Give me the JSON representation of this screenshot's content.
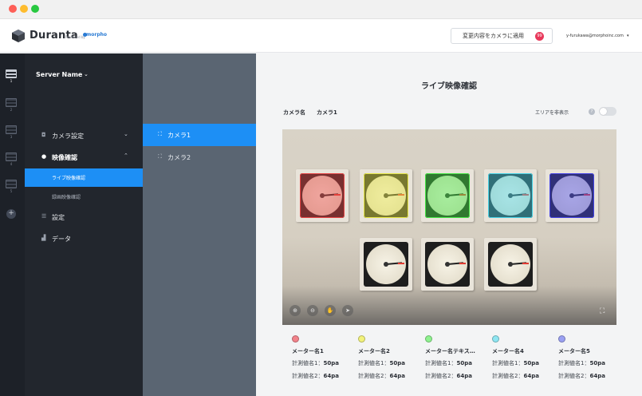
{
  "header": {
    "logo_text": "Duranta",
    "produced_by": "Produced by",
    "brand": "morpho",
    "apply_button": "変更内容をカメラに適用",
    "apply_badge": "99",
    "user_email": "y-furukawa@morphoinc.com",
    "user_caret": "▾"
  },
  "rail": {
    "items": [
      {
        "num": "1",
        "active": true
      },
      {
        "num": "2",
        "active": false
      },
      {
        "num": "3",
        "active": false
      },
      {
        "num": "4",
        "active": false
      },
      {
        "num": "5",
        "active": false
      }
    ],
    "add": "+"
  },
  "nav": {
    "server_name": "Server Name",
    "server_caret": "⌄",
    "camera_settings": "カメラ設定",
    "video_check": "映像確認",
    "live_check": "ライブ映像確認",
    "recorded_check": "録画映像確認",
    "settings": "設定",
    "data": "データ"
  },
  "cameras": [
    {
      "label": "カメラ1",
      "active": true
    },
    {
      "label": "カメラ2",
      "active": false
    }
  ],
  "main": {
    "title": "ライブ映像確認",
    "camera_name_label": "カメラ名",
    "camera_name_value": "カメラ1",
    "area_hide_label": "エリアを非表示",
    "help": "?"
  },
  "gauges": {
    "top_row_colors": [
      "#e64646",
      "#e6e646",
      "#46e646",
      "#46d2e6",
      "#4646e6"
    ]
  },
  "meters": [
    {
      "name": "メーター名1",
      "color": "#f2828a",
      "row1_label": "計測値名1：",
      "row1_value": "50pa",
      "row2_label": "計測値名2：",
      "row2_value": "64pa"
    },
    {
      "name": "メーター名2",
      "color": "#f2f27a",
      "row1_label": "計測値名1：",
      "row1_value": "50pa",
      "row2_label": "計測値名2：",
      "row2_value": "64pa"
    },
    {
      "name": "メーター名テキス…",
      "color": "#8ef28e",
      "row1_label": "計測値名1：",
      "row1_value": "50pa",
      "row2_label": "計測値名2：",
      "row2_value": "64pa"
    },
    {
      "name": "メーター名4",
      "color": "#8ee6f2",
      "row1_label": "計測値名1：",
      "row1_value": "50pa",
      "row2_label": "計測値名2：",
      "row2_value": "64pa"
    },
    {
      "name": "メーター名5",
      "color": "#9aa0f2",
      "row1_label": "計測値名1：",
      "row1_value": "50pa",
      "row2_label": "計測値名2：",
      "row2_value": "64pa"
    }
  ],
  "icons": {
    "camera_settings": "camera-icon",
    "video_check": "play-circle-icon",
    "settings": "sliders-icon",
    "data": "bar-chart-icon",
    "camera_item": "camera-icon",
    "zoom_in": "zoom-in-icon",
    "zoom_out": "zoom-out-icon",
    "pan": "hand-icon",
    "pointer": "pointer-icon",
    "fullscreen": "fullscreen-icon"
  },
  "colors": {
    "accent": "#1d8ff5",
    "badge": "#e8385a",
    "nav_bg": "#22262d",
    "rail_bg": "#1d2128",
    "camera_list_bg": "#5a6572"
  }
}
